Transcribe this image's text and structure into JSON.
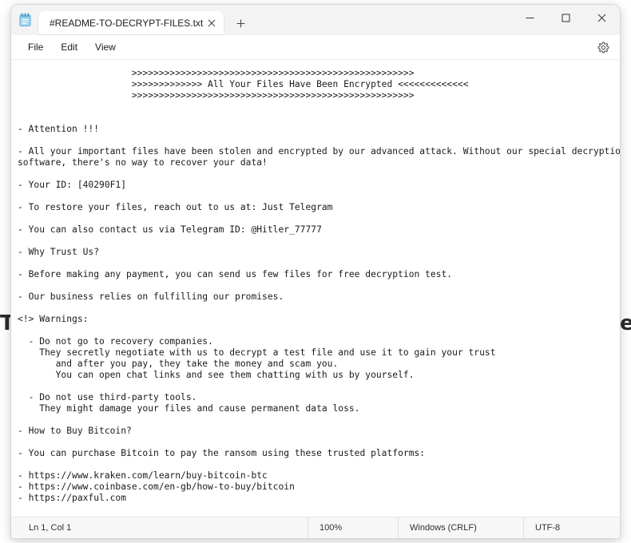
{
  "window": {
    "app_icon": "notepad-icon",
    "controls": {
      "minimize": "minimize-icon",
      "maximize": "maximize-icon",
      "close": "close-icon"
    }
  },
  "tabs": [
    {
      "title": "#README-TO-DECRYPT-FILES.txt",
      "close_icon": "close-icon",
      "active": true
    }
  ],
  "new_tab": {
    "icon": "plus-icon",
    "label": "+"
  },
  "menubar": {
    "items": [
      {
        "label": "File"
      },
      {
        "label": "Edit"
      },
      {
        "label": "View"
      }
    ],
    "settings_icon": "gear-icon"
  },
  "document": {
    "text": "                     >>>>>>>>>>>>>>>>>>>>>>>>>>>>>>>>>>>>>>>>>>>>>>>>>>>>\n                     >>>>>>>>>>>>> All Your Files Have Been Encrypted <<<<<<<<<<<<<\n                     >>>>>>>>>>>>>>>>>>>>>>>>>>>>>>>>>>>>>>>>>>>>>>>>>>>>\n\n\n- Attention !!!\n\n- All your important files have been stolen and encrypted by our advanced attack. Without our special decryption\nsoftware, there's no way to recover your data!\n\n- Your ID: [40290F1]\n\n- To restore your files, reach out to us at: Just Telegram\n\n- You can also contact us via Telegram ID: @Hitler_77777\n\n- Why Trust Us?\n\n- Before making any payment, you can send us few files for free decryption test.\n\n- Our business relies on fulfilling our promises.\n\n<!> Warnings:\n\n  - Do not go to recovery companies.\n    They secretly negotiate with us to decrypt a test file and use it to gain your trust\n       and after you pay, they take the money and scam you.\n       You can open chat links and see them chatting with us by yourself.\n\n  - Do not use third-party tools.\n    They might damage your files and cause permanent data loss.\n\n- How to Buy Bitcoin?\n\n- You can purchase Bitcoin to pay the ransom using these trusted platforms:\n\n- https://www.kraken.com/learn/buy-bitcoin-btc\n- https://www.coinbase.com/en-gb/how-to-buy/bitcoin\n- https://paxful.com"
  },
  "statusbar": {
    "position": "Ln 1, Col 1",
    "zoom": "100%",
    "line_ending": "Windows (CRLF)",
    "encoding": "UTF-8"
  },
  "watermark": {
    "left_letter": "T",
    "right_letter": "e"
  },
  "colors": {
    "titlebar": "#f3f3f3",
    "tab_active": "#ffffff",
    "editor_bg": "#ffffff",
    "text": "#1a1a1a",
    "statusbar": "#f7f7f7",
    "icon_blue": "#5aa9dc"
  }
}
